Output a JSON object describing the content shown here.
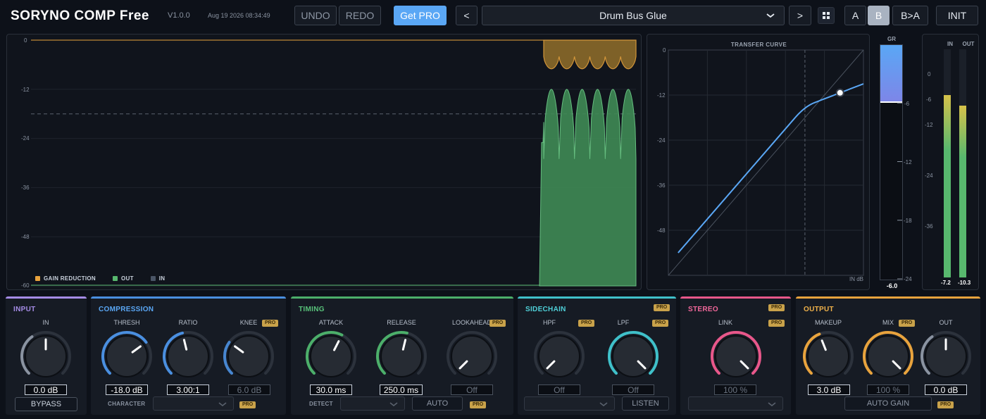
{
  "header": {
    "title": "SORYNO COMP Free",
    "version": "V1.0.0",
    "date": "Aug 19 2026 08:34:49",
    "undo": "UNDO",
    "redo": "REDO",
    "get_pro": "Get PRO",
    "prev": "<",
    "next": ">",
    "preset": "Drum Bus Glue",
    "ab_a": "A",
    "ab_b": "B",
    "b_to_a": "B>A",
    "init": "INIT",
    "active_slot": "B"
  },
  "history": {
    "y_ticks": [
      "0",
      "-12",
      "-24",
      "-36",
      "-48",
      "-60"
    ],
    "threshold_db": -18,
    "legend": {
      "gr": "GAIN REDUCTION",
      "out": "OUT",
      "in": "IN"
    },
    "colors": {
      "gr": "#e8a33d",
      "out": "#58b86e",
      "in": "#4a5566"
    }
  },
  "transfer": {
    "title": "TRANSFER CURVE",
    "y_ticks": [
      "0",
      "-12",
      "-24",
      "-36",
      "-48"
    ],
    "axis_label": "IN dB",
    "threshold_db": -18,
    "ratio": 3.0,
    "knee_db": 6.0,
    "makeup_db": 3.0,
    "curve_color": "#5aa7f5"
  },
  "gr_meter": {
    "label": "GR",
    "ticks": [
      "-6",
      "-12",
      "-18",
      "-24"
    ],
    "value": "-6.0",
    "gr_db": -6.0
  },
  "io_meters": {
    "in_label": "IN",
    "out_label": "OUT",
    "ticks": [
      "0",
      "-6",
      "-12",
      "-24",
      "-36"
    ],
    "in_value": "-7.2",
    "out_value": "-10.3",
    "in_db": -7.2,
    "out_db": -10.3
  },
  "modules": {
    "input": {
      "title": "INPUT",
      "color": "#a58ce6",
      "in_label": "IN",
      "in_value": "0.0 dB",
      "in_level": 0.5,
      "bypass": "BYPASS"
    },
    "compression": {
      "title": "COMPRESSION",
      "color": "#4a8fe0",
      "thresh_label": "THRESH",
      "thresh_value": "-18.0 dB",
      "thresh_level": 0.7,
      "ratio_label": "RATIO",
      "ratio_value": "3.00:1",
      "ratio_level": 0.45,
      "knee_label": "KNEE",
      "knee_value": "6.0 dB",
      "knee_level": 0.3,
      "character_label": "CHARACTER",
      "pro": "PRO"
    },
    "timing": {
      "title": "TIMING",
      "color": "#4caf6a",
      "attack_label": "ATTACK",
      "attack_value": "30.0 ms",
      "attack_level": 0.6,
      "release_label": "RELEASE",
      "release_value": "250.0 ms",
      "release_level": 0.55,
      "lookahead_label": "LOOKAHEAD",
      "lookahead_value": "Off",
      "lookahead_level": 0.0,
      "detect_label": "DETECT",
      "auto": "AUTO",
      "pro": "PRO"
    },
    "sidechain": {
      "title": "SIDECHAIN",
      "color": "#3fc0c9",
      "hpf_label": "HPF",
      "hpf_value": "Off",
      "hpf_level": 0.0,
      "lpf_label": "LPF",
      "lpf_value": "Off",
      "lpf_level": 1.0,
      "listen": "LISTEN",
      "pro": "PRO"
    },
    "stereo": {
      "title": "STEREO",
      "color": "#e8578a",
      "link_label": "LINK",
      "link_value": "100 %",
      "link_level": 1.0,
      "pro": "PRO"
    },
    "output": {
      "title": "OUTPUT",
      "color": "#e8a33d",
      "makeup_label": "MAKEUP",
      "makeup_value": "3.0 dB",
      "makeup_level": 0.42,
      "mix_label": "MIX",
      "mix_value": "100 %",
      "mix_level": 1.0,
      "out_label": "OUT",
      "out_value": "0.0 dB",
      "out_level": 0.5,
      "auto_gain": "AUTO GAIN",
      "pro": "PRO"
    }
  }
}
